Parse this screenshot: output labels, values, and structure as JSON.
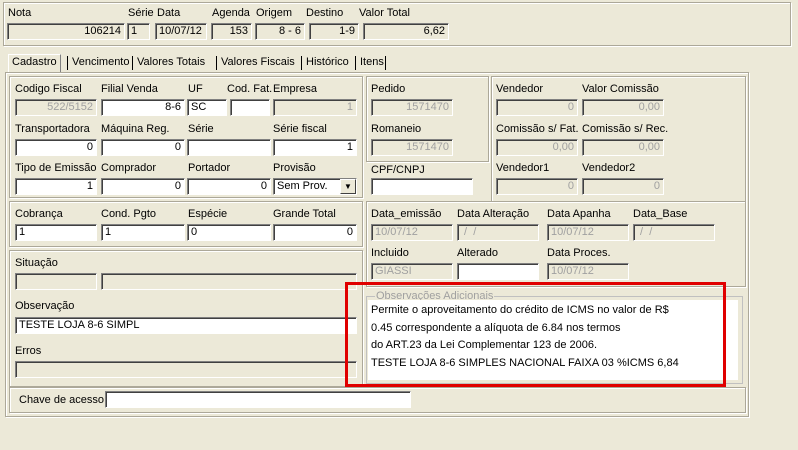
{
  "header": {
    "nota_label": "Nota",
    "nota_value": "106214",
    "serie_label": "Série",
    "serie_value": "1",
    "data_label": "Data",
    "data_value": "10/07/12",
    "agenda_label": "Agenda",
    "agenda_value": "153",
    "origem_label": "Origem",
    "origem_value": "8 - 6",
    "destino_label": "Destino",
    "destino_value": "1-9",
    "valor_total_label": "Valor Total",
    "valor_total_value": "6,62"
  },
  "tabs": {
    "cadastro": "Cadastro",
    "vencimento": "Vencimento",
    "valores_totais": "Valores Totais",
    "valores_fiscais": "Valores Fiscais",
    "historico": "Histórico",
    "itens": "Itens"
  },
  "cadastro": {
    "codigo_fiscal_label": "Codigo Fiscal",
    "codigo_fiscal_value": "522/5152",
    "filial_venda_label": "Filial Venda",
    "filial_venda_value": "8-6",
    "uf_label": "UF",
    "uf_value": "SC",
    "cod_fat_label": "Cod. Fat.",
    "cod_fat_value": "",
    "empresa_label": "Empresa",
    "empresa_value": "1",
    "transportadora_label": "Transportadora",
    "transportadora_value": "0",
    "maquina_reg_label": "Máquina Reg.",
    "maquina_reg_value": "0",
    "serie_label": "Série",
    "serie_value": "",
    "serie_fiscal_label": "Série fiscal",
    "serie_fiscal_value": "1",
    "tipo_emissao_label": "Tipo de Emissão",
    "tipo_emissao_value": "1",
    "comprador_label": "Comprador",
    "comprador_value": "0",
    "portador_label": "Portador",
    "portador_value": "0",
    "provisao_label": "Provisão",
    "provisao_value": "Sem Prov.",
    "cobranca_label": "Cobrança",
    "cobranca_value": "1",
    "cond_pgto_label": "Cond. Pgto",
    "cond_pgto_value": "1",
    "especie_label": "Espécie",
    "especie_value": "0",
    "grande_total_label": "Grande Total",
    "grande_total_value": "0",
    "situacao_label": "Situação",
    "observacao_label": "Observação",
    "observacao_value": "TESTE LOJA 8-6 SIMPL",
    "erros_label": "Erros"
  },
  "right": {
    "pedido_label": "Pedido",
    "pedido_value": "1571470",
    "romaneio_label": "Romaneio",
    "romaneio_value": "1571470",
    "vendedor_label": "Vendedor",
    "vendedor_value": "0",
    "valor_comissao_label": "Valor Comissão",
    "valor_comissao_value": "0,00",
    "comissao_fat_label": "Comissão s/ Fat.",
    "comissao_fat_value": "0,00",
    "comissao_rec_label": "Comissão s/ Rec.",
    "comissao_rec_value": "0,00",
    "cpf_cnpj_label": "CPF/CNPJ",
    "vendedor1_label": "Vendedor1",
    "vendedor1_value": "0",
    "vendedor2_label": "Vendedor2",
    "vendedor2_value": "0",
    "data_emissao_label": "Data_emissão",
    "data_emissao_value": "10/07/12",
    "data_alteracao_label": "Data Alteração",
    "data_alteracao_value": " /  /",
    "data_apanha_label": "Data Apanha",
    "data_apanha_value": "10/07/12",
    "data_base_label": "Data_Base",
    "data_base_value": " /  /",
    "incluido_label": "Incluido",
    "incluido_value": "GIASSI",
    "alterado_label": "Alterado",
    "alterado_value": "",
    "data_proces_label": "Data Proces.",
    "data_proces_value": "10/07/12"
  },
  "observacoes": {
    "legend": "Observações Adicionais",
    "lines": [
      "Permite o aproveitamento do crédito de ICMS  no valor de R$",
      "0.45 correspondente a alíquota de  6.84 nos termos",
      "do ART.23 da Lei Complementar 123 de 2006.",
      "TESTE LOJA 8-6 SIMPLES NACIONAL FAIXA 03 %ICMS 6,84"
    ]
  },
  "chave": {
    "label": "Chave de acesso:",
    "value": ""
  },
  "highlight_color": "#e00000"
}
